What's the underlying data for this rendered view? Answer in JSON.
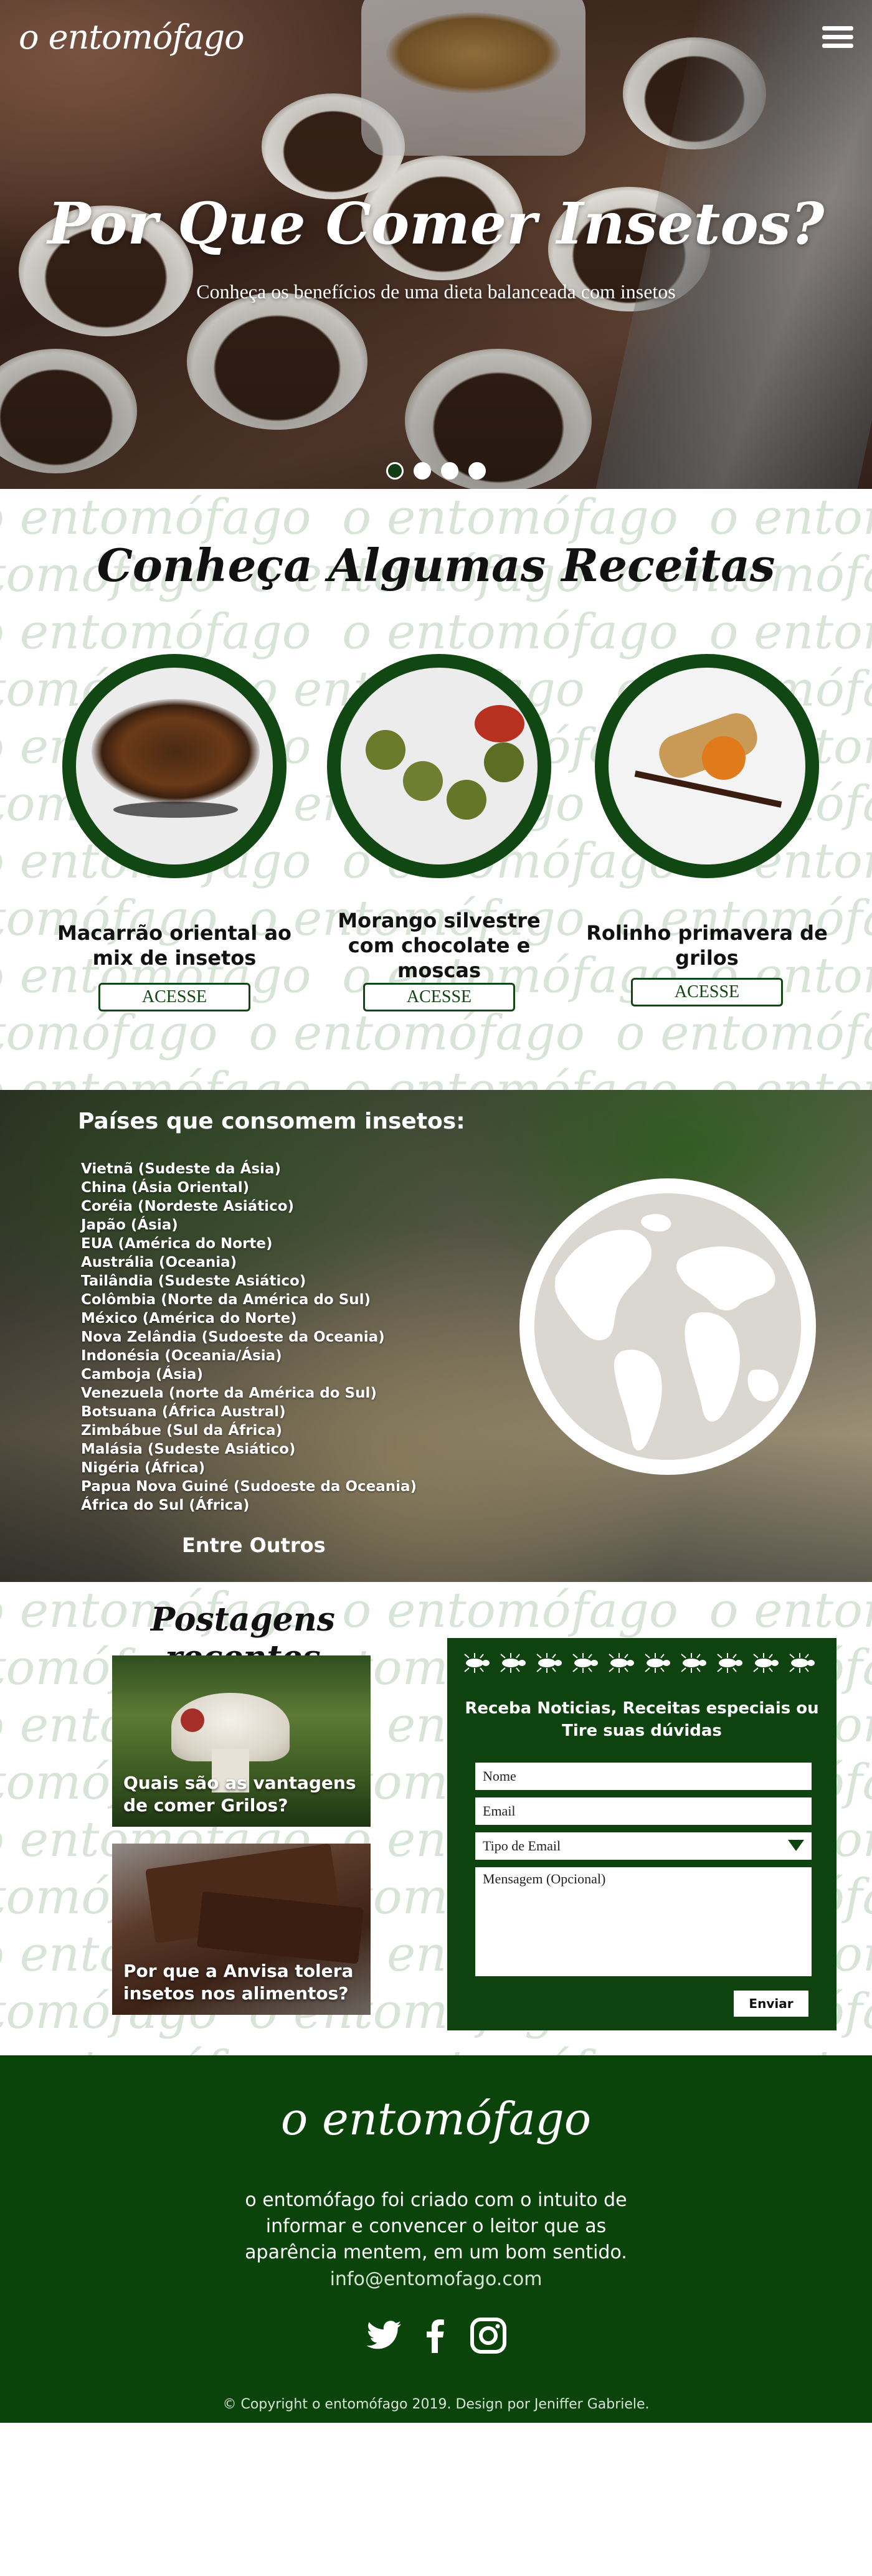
{
  "header": {
    "logo": "o entomófago",
    "menu_icon": "hamburger-menu-icon"
  },
  "hero": {
    "title": "Por Que Comer Insetos?",
    "subtitle": "Conheça os benefícios de uma dieta balanceada com insetos",
    "slides": 4,
    "active_slide": 1
  },
  "recipes": {
    "title": "Conheça Algumas Receitas",
    "watermark": "o entomófago",
    "button_label": "ACESSE",
    "items": [
      {
        "name": "Macarrão oriental ao mix de insetos"
      },
      {
        "name": "Morango silvestre com chocolate e moscas"
      },
      {
        "name": "Rolinho primavera de grilos"
      }
    ]
  },
  "countries": {
    "title": "Países que consomem insetos:",
    "list": [
      "Vietnã (Sudeste da Ásia)",
      "China (Ásia Oriental)",
      "Coréia (Nordeste Asiático)",
      "Japão (Ásia)",
      "EUA (América do Norte)",
      "Austrália (Oceania)",
      "Tailândia (Sudeste Asiático)",
      "Colômbia (Norte da América do Sul)",
      "México (América do Norte)",
      "Nova Zelândia (Sudoeste da Oceania)",
      "Indonésia (Oceania/Ásia)",
      "Camboja (Ásia)",
      "Venezuela (norte da América do Sul)",
      "Botsuana (África Austral)",
      "Zimbábue (Sul da África)",
      "Malásia (Sudeste Asiático)",
      "Nigéria (África)",
      "Papua Nova Guiné (Sudoeste da Oceania)",
      "África do Sul (África)"
    ],
    "more": "Entre Outros"
  },
  "posts": {
    "title": "Postagens recentes",
    "items": [
      {
        "title": "Quais são as vantagens de comer Grilos?"
      },
      {
        "title": "Por que a Anvisa tolera insetos nos alimentos?"
      }
    ]
  },
  "newsletter": {
    "title": "Receba Noticias, Receitas especiais ou Tire suas dúvidas",
    "name_placeholder": "Nome",
    "email_placeholder": "Email",
    "type_label": "Tipo de Email",
    "message_placeholder": "Mensagem (Opcional)",
    "send_label": "Enviar"
  },
  "footer": {
    "logo": "o entomófago",
    "text": "o entomófago foi criado com o intuito de informar e convencer o leitor que as aparência mentem, em um bom sentido.",
    "email": "info@entomofago.com",
    "socials": [
      "twitter-icon",
      "facebook-icon",
      "instagram-icon"
    ],
    "copyright": "© Copyright o entomófago 2019. Design por Jeniffer Gabriele."
  },
  "colors": {
    "brand_green": "#0e420f",
    "footer_green": "#0a440a",
    "watermark": "#d9e4d9"
  }
}
